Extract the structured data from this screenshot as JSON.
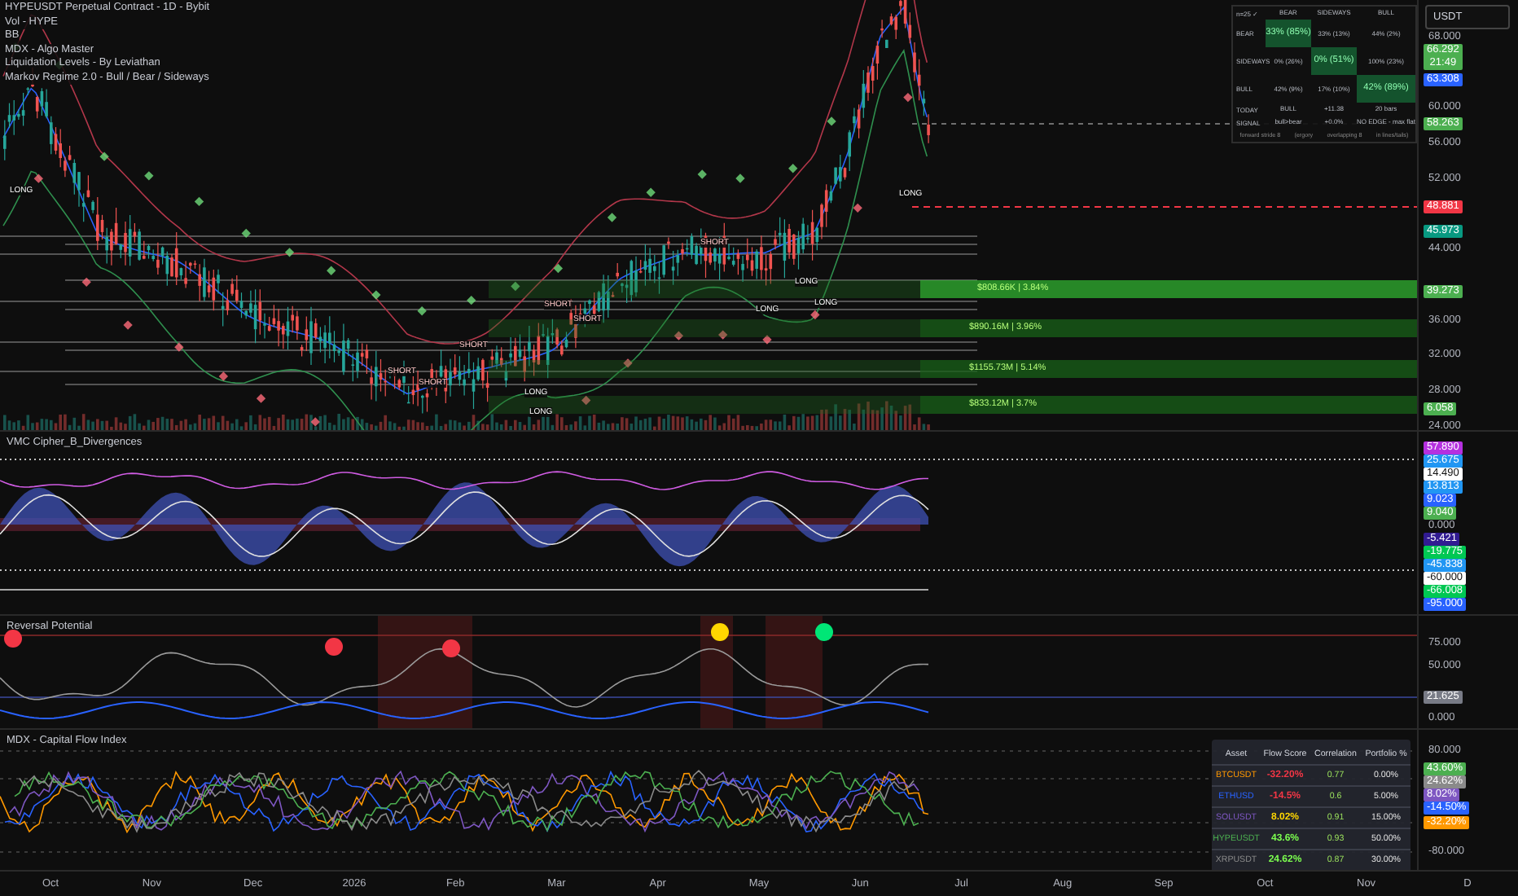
{
  "main_chart": {
    "legend": [
      "HYPEUSDT Perpetual Contract - 1D - Bybit",
      "Vol - HYPE",
      "BB",
      "MDX - Algo Master",
      "Liquidation Levels - By Leviathan",
      "Markov Regime 2.0 - Bull / Bear / Sideways"
    ],
    "currency_button": "USDT",
    "markov_table": {
      "corner": "n=25 ✓",
      "columns": [
        "BEAR",
        "SIDEWAYS",
        "BULL"
      ],
      "rows": [
        {
          "label": "BEAR",
          "cells": [
            {
              "text": "33% (85%)",
              "highlighted": true
            },
            {
              "text": "33% (13%)",
              "highlighted": false
            },
            {
              "text": "44% (2%)",
              "highlighted": false
            }
          ]
        },
        {
          "label": "SIDEWAYS",
          "cells": [
            {
              "text": "0% (26%)",
              "highlighted": false
            },
            {
              "text": "0% (51%)",
              "highlighted": true
            },
            {
              "text": "100% (23%)",
              "highlighted": false
            }
          ]
        },
        {
          "label": "BULL",
          "cells": [
            {
              "text": "42% (9%)",
              "highlighted": false
            },
            {
              "text": "17% (10%)",
              "highlighted": false
            },
            {
              "text": "42% (89%)",
              "highlighted": true
            }
          ]
        },
        {
          "label": "TODAY",
          "cells": [
            {
              "text": "BULL",
              "highlighted": false
            },
            {
              "text": "+11.38",
              "highlighted": false
            },
            {
              "text": "20 bars",
              "highlighted": false
            }
          ]
        },
        {
          "label": "SIGNAL",
          "cells": [
            {
              "text": "bull>bear",
              "highlighted": false
            },
            {
              "text": "+0.0%",
              "highlighted": false
            },
            {
              "text": "NO EDGE - max flat",
              "highlighted": false
            }
          ]
        }
      ],
      "footer": [
        "forward stride 8",
        "(ergory",
        "overlapping 8",
        "in lines/tails)"
      ]
    },
    "signals": [
      {
        "label": "LONG",
        "kind": "long"
      },
      {
        "label": "SHORT",
        "kind": "short"
      },
      {
        "label": "SHORT",
        "kind": "short"
      },
      {
        "label": "SHORT",
        "kind": "short"
      },
      {
        "label": "LONG",
        "kind": "long"
      },
      {
        "label": "LONG",
        "kind": "long"
      },
      {
        "label": "SHORT",
        "kind": "short"
      },
      {
        "label": "SHORT",
        "kind": "short"
      },
      {
        "label": "SHORT",
        "kind": "short"
      },
      {
        "label": "LONG",
        "kind": "long"
      },
      {
        "label": "LONG",
        "kind": "long"
      },
      {
        "label": "LONG",
        "kind": "long"
      },
      {
        "label": "LONG",
        "kind": "long"
      }
    ],
    "liquidation_levels": [
      {
        "label": "$808.66K | 3.84%"
      },
      {
        "label": "$890.16M | 3.96%"
      },
      {
        "label": "$1155.73M | 5.14%"
      },
      {
        "label": "$833.12M | 3.7%"
      }
    ],
    "axis": [
      {
        "text": "68.000",
        "kind": "tick"
      },
      {
        "text": "66.292",
        "kind": "badge",
        "color": "#4caf50",
        "sub": "21:49"
      },
      {
        "text": "63.308",
        "kind": "badge",
        "color": "#2962ff"
      },
      {
        "text": "60.000",
        "kind": "tick"
      },
      {
        "text": "58.263",
        "kind": "badge",
        "color": "#4caf50"
      },
      {
        "text": "56.000",
        "kind": "tick"
      },
      {
        "text": "52.000",
        "kind": "tick"
      },
      {
        "text": "48.881",
        "kind": "badge",
        "color": "#f23645"
      },
      {
        "text": "45.973",
        "kind": "badge",
        "color": "#089981"
      },
      {
        "text": "44.000",
        "kind": "tick"
      },
      {
        "text": "39.273",
        "kind": "badge",
        "color": "#4caf50"
      },
      {
        "text": "36.000",
        "kind": "tick"
      },
      {
        "text": "32.000",
        "kind": "tick"
      },
      {
        "text": "28.000",
        "kind": "tick"
      },
      {
        "text": "6.058",
        "kind": "badge",
        "color": "#4caf50"
      },
      {
        "text": "24.000",
        "kind": "tick"
      }
    ]
  },
  "vmc_pane": {
    "title": "VMC Cipher_B_Divergences",
    "axis": [
      {
        "text": "57.890",
        "kind": "badge",
        "color": "#b530e0"
      },
      {
        "text": "25.675",
        "kind": "badge",
        "color": "#2196f3"
      },
      {
        "text": "14.490",
        "kind": "badge",
        "color": "#ffffff"
      },
      {
        "text": "13.813",
        "kind": "badge",
        "color": "#2196f3"
      },
      {
        "text": "9.023",
        "kind": "badge",
        "color": "#2962ff"
      },
      {
        "text": "9.040",
        "kind": "badge",
        "color": "#4caf50"
      },
      {
        "text": "0.000",
        "kind": "tick"
      },
      {
        "text": "-5.421",
        "kind": "badge",
        "color": "#311b92"
      },
      {
        "text": "-19.775",
        "kind": "badge",
        "color": "#00c853"
      },
      {
        "text": "-45.838",
        "kind": "badge",
        "color": "#2196f3"
      },
      {
        "text": "-60.000",
        "kind": "badge",
        "color": "#ffffff"
      },
      {
        "text": "-66.008",
        "kind": "badge",
        "color": "#00c853"
      },
      {
        "text": "-95.000",
        "kind": "badge",
        "color": "#2962ff"
      }
    ]
  },
  "reversal_pane": {
    "title": "Reversal Potential",
    "axis": [
      {
        "text": "75.000",
        "kind": "tick"
      },
      {
        "text": "50.000",
        "kind": "tick"
      },
      {
        "text": "21.625",
        "kind": "badge",
        "color": "#787b86"
      },
      {
        "text": "0.000",
        "kind": "tick"
      }
    ]
  },
  "flow_pane": {
    "title": "MDX - Capital Flow Index",
    "axis": [
      {
        "text": "80.000",
        "kind": "tick"
      },
      {
        "text": "43.60%",
        "kind": "badge",
        "color": "#4caf50"
      },
      {
        "text": "24.62%",
        "kind": "badge",
        "color": "#8a8a8a"
      },
      {
        "text": "8.02%",
        "kind": "badge",
        "color": "#7e57c2"
      },
      {
        "text": "-14.50%",
        "kind": "badge",
        "color": "#2962ff"
      },
      {
        "text": "-32.20%",
        "kind": "badge",
        "color": "#ff9800"
      },
      {
        "text": "-80.000",
        "kind": "tick"
      }
    ],
    "table": {
      "columns": [
        "Asset",
        "Flow Score",
        "Correlation",
        "Portfolio %"
      ],
      "rows": [
        {
          "asset": "BTCUSDT",
          "color": "#ff9800",
          "flow": {
            "text": "-32.20%",
            "color": "#f23645"
          },
          "correlation": "0.77",
          "portfolio": "0.00%"
        },
        {
          "asset": "ETHUSD",
          "color": "#2962ff",
          "flow": {
            "text": "-14.5%",
            "color": "#f23645"
          },
          "correlation": "0.6",
          "portfolio": "5.00%"
        },
        {
          "asset": "SOLUSDT",
          "color": "#7e57c2",
          "flow": {
            "text": "8.02%",
            "color": "#ffd600"
          },
          "correlation": "0.91",
          "portfolio": "15.00%"
        },
        {
          "asset": "HYPEUSDT",
          "color": "#4caf50",
          "flow": {
            "text": "43.6%",
            "color": "#7cff4f"
          },
          "correlation": "0.93",
          "portfolio": "50.00%"
        },
        {
          "asset": "XRPUSDT",
          "color": "#8a8a8a",
          "flow": {
            "text": "24.62%",
            "color": "#7cff4f"
          },
          "correlation": "0.87",
          "portfolio": "30.00%"
        }
      ]
    }
  },
  "time_axis": [
    "Oct",
    "Nov",
    "Dec",
    "2026",
    "Feb",
    "Mar",
    "Apr",
    "May",
    "Jun",
    "Jul",
    "Aug",
    "Sep",
    "Oct",
    "Nov",
    "D"
  ]
}
